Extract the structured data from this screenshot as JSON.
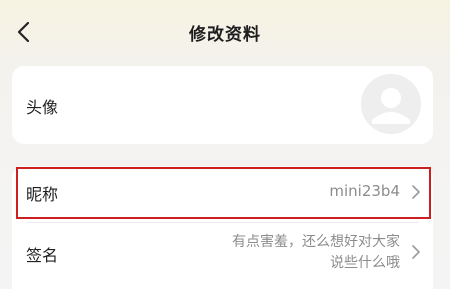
{
  "header": {
    "title": "修改资料"
  },
  "avatar_row": {
    "label": "头像"
  },
  "nickname_row": {
    "label": "昵称",
    "value": "mini23b4"
  },
  "signature_row": {
    "label": "签名",
    "value_line1": "有点害羞，还么想好对大家",
    "value_line2": "说些什么哦"
  },
  "colors": {
    "highlight": "#cc1f1f",
    "secondary_text": "#8c8c8c",
    "card_bg": "#ffffff"
  },
  "icons": {
    "back": "chevron-left-icon",
    "row_arrow": "chevron-right-icon",
    "avatar": "user-silhouette-icon"
  }
}
